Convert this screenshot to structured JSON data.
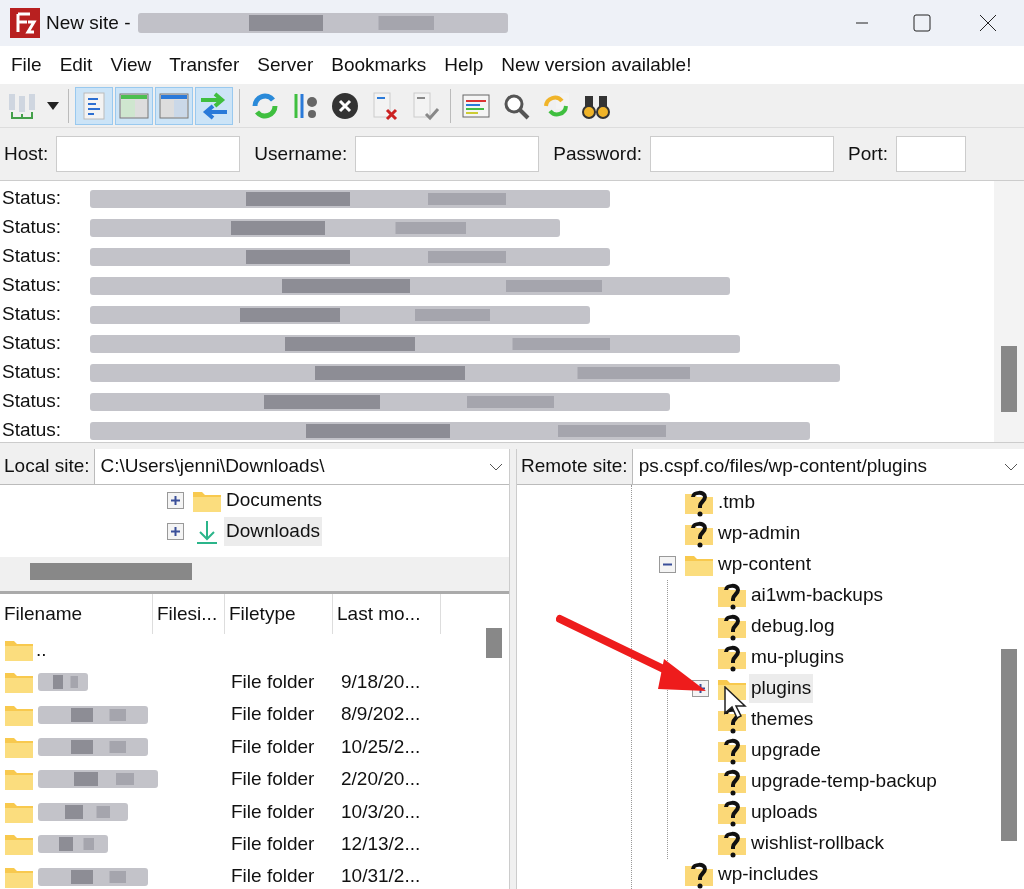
{
  "window": {
    "title": "New site -"
  },
  "menu": [
    "File",
    "Edit",
    "View",
    "Transfer",
    "Server",
    "Bookmarks",
    "Help",
    "New version available!"
  ],
  "toolbar": [
    [
      {
        "kind": "servers",
        "pressed": false
      }
    ],
    [
      {
        "kind": "log",
        "pressed": true
      },
      {
        "kind": "left-panel",
        "pressed": true
      },
      {
        "kind": "right-panel",
        "pressed": true
      },
      {
        "kind": "arrows",
        "pressed": true
      }
    ],
    [
      {
        "kind": "refresh",
        "pressed": false
      },
      {
        "kind": "filter",
        "pressed": false
      },
      {
        "kind": "cancel",
        "pressed": false
      },
      {
        "kind": "doc-x",
        "pressed": false
      },
      {
        "kind": "doc-check",
        "pressed": false
      }
    ],
    [
      {
        "kind": "list",
        "pressed": false
      },
      {
        "kind": "magnifier",
        "pressed": false
      },
      {
        "kind": "sync",
        "pressed": false
      },
      {
        "kind": "binoculars",
        "pressed": false
      }
    ]
  ],
  "quickconnect": [
    {
      "label": "Host:"
    },
    {
      "label": "Username:"
    },
    {
      "label": "Password:"
    },
    {
      "label": "Port:"
    }
  ],
  "log": [
    {
      "label": "Status:"
    },
    {
      "label": "Status:"
    },
    {
      "label": "Status:"
    },
    {
      "label": "Status:"
    },
    {
      "label": "Status:"
    },
    {
      "label": "Status:"
    },
    {
      "label": "Status:"
    },
    {
      "label": "Status:"
    },
    {
      "label": "Status:"
    }
  ],
  "local": {
    "label": "Local site:",
    "path": "C:\\Users\\jenni\\Downloads\\",
    "tree": [
      {
        "name": "Documents",
        "kind": "folder",
        "selected": false
      },
      {
        "name": "Downloads",
        "kind": "download",
        "selected": true
      }
    ],
    "columns": [
      "Filename",
      "Filesi...",
      "Filetype",
      "Last mo..."
    ],
    "parent": "..",
    "rows": [
      {
        "type": "File folder",
        "modified": "9/18/20..."
      },
      {
        "type": "File folder",
        "modified": "8/9/202..."
      },
      {
        "type": "File folder",
        "modified": "10/25/2..."
      },
      {
        "type": "File folder",
        "modified": "2/20/20..."
      },
      {
        "type": "File folder",
        "modified": "10/3/20..."
      },
      {
        "type": "File folder",
        "modified": "12/13/2..."
      },
      {
        "type": "File folder",
        "modified": "10/31/2..."
      }
    ]
  },
  "remote": {
    "label": "Remote site:",
    "path": "ps.cspf.co/files/wp-content/plugins",
    "tree": [
      {
        "name": ".tmb",
        "kind": "unknown",
        "selected": false
      },
      {
        "name": "wp-admin",
        "kind": "unknown",
        "selected": false
      },
      {
        "name": "wp-content",
        "kind": "folder",
        "expanded": true,
        "selected": false,
        "children": [
          {
            "name": "ai1wm-backups",
            "kind": "unknown",
            "selected": false
          },
          {
            "name": "debug.log",
            "kind": "unknown",
            "selected": false
          },
          {
            "name": "mu-plugins",
            "kind": "unknown",
            "selected": false
          },
          {
            "name": "plugins",
            "kind": "folder",
            "expanded": false,
            "selected": true
          },
          {
            "name": "themes",
            "kind": "unknown",
            "selected": false
          },
          {
            "name": "upgrade",
            "kind": "unknown",
            "selected": false
          },
          {
            "name": "upgrade-temp-backup",
            "kind": "unknown",
            "selected": false
          },
          {
            "name": "uploads",
            "kind": "unknown",
            "selected": false
          },
          {
            "name": "wishlist-rollback",
            "kind": "unknown",
            "selected": false
          }
        ]
      },
      {
        "name": "wp-includes",
        "kind": "unknown",
        "selected": false
      }
    ]
  }
}
